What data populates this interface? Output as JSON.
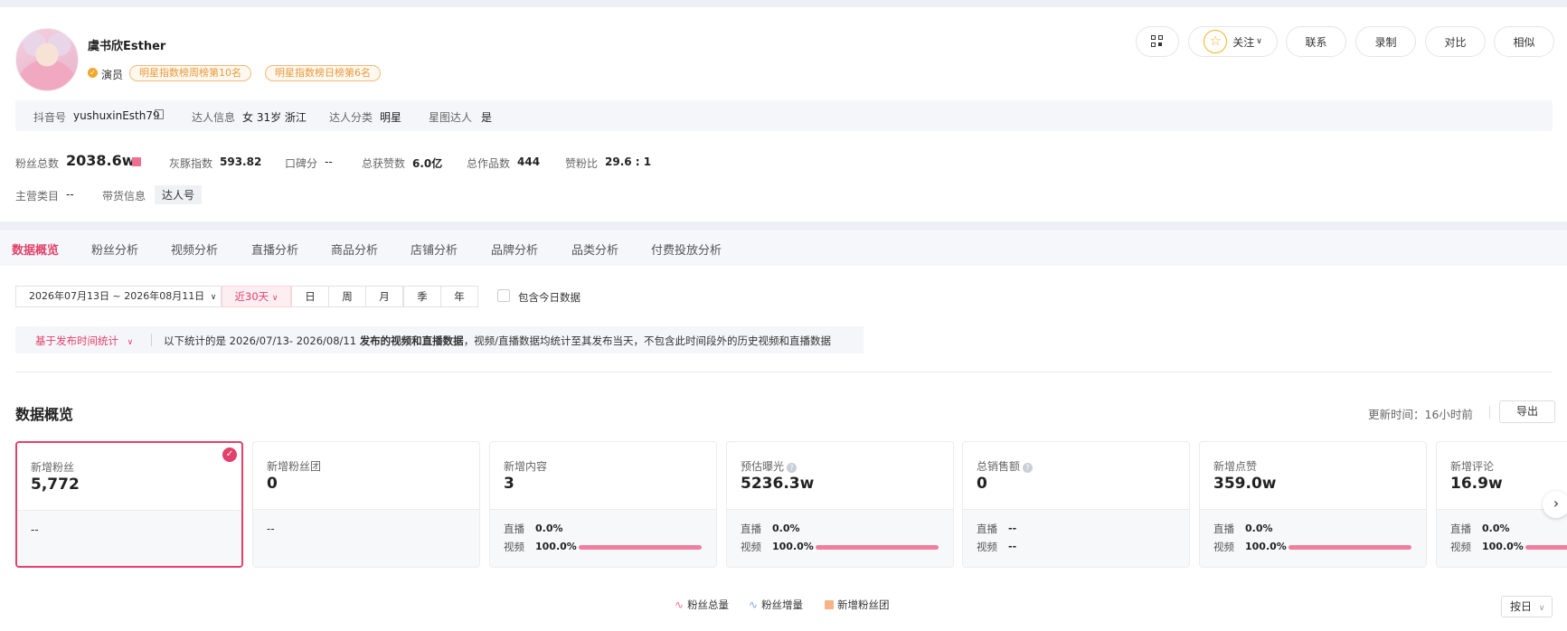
{
  "profile": {
    "name": "虞书欣Esther",
    "role": "演员",
    "rank_tags": [
      "明星指数榜周榜第10名",
      "明星指数榜日榜第6名"
    ]
  },
  "header_buttons": {
    "follow": "关注",
    "contact": "联系",
    "record": "录制",
    "compare": "对比",
    "similar": "相似"
  },
  "info": {
    "douyin_label": "抖音号",
    "douyin_value": "yushuxinEsth79",
    "talent_label": "达人信息",
    "talent_value": "女 31岁 浙江",
    "category_label": "达人分类",
    "category_value": "明星",
    "xingtu_label": "星图达人",
    "xingtu_value": "是"
  },
  "stats": {
    "fans_label": "粉丝总数",
    "fans_value": "2038.6w",
    "grey_label": "灰豚指数",
    "grey_value": "593.82",
    "reputation_label": "口碑分",
    "reputation_value": "--",
    "likes_label": "总获赞数",
    "likes_value": "6.0亿",
    "works_label": "总作品数",
    "works_value": "444",
    "ratio_label": "赞粉比",
    "ratio_value": "29.6 : 1",
    "main_cat_label": "主营类目",
    "main_cat_value": "--",
    "goods_label": "带货信息",
    "goods_value": "达人号"
  },
  "tabs": [
    "数据概览",
    "粉丝分析",
    "视频分析",
    "直播分析",
    "商品分析",
    "店铺分析",
    "品牌分析",
    "品类分析",
    "付费投放分析"
  ],
  "filters": {
    "date_range": "2026年07月13日 ~ 2026年08月11日",
    "segments": [
      "近30天",
      "日",
      "周",
      "月",
      "季",
      "年"
    ],
    "include_today": "包含今日数据"
  },
  "note": {
    "basis": "基于发布时间统计",
    "prefix": "以下统计的是 2026/07/13- 2026/08/11 ",
    "bold": "发布的视频和直播数据",
    "suffix": "，视频/直播数据均统计至其发布当天，不包含此时间段外的历史视频和直播数据"
  },
  "overview": {
    "title": "数据概览",
    "update": "更新时间：16小时前",
    "export": "导出"
  },
  "cards": [
    {
      "label": "新增粉丝",
      "value": "5,772",
      "dash": "--"
    },
    {
      "label": "新增粉丝团",
      "value": "0",
      "dash": "--"
    },
    {
      "label": "新增内容",
      "value": "3",
      "live_label": "直播",
      "live": "0.0%",
      "video_label": "视频",
      "video": "100.0%",
      "video_share": 1.0
    },
    {
      "label": "预估曝光",
      "value": "5236.3w",
      "live_label": "直播",
      "live": "0.0%",
      "video_label": "视频",
      "video": "100.0%",
      "video_share": 1.0
    },
    {
      "label": "总销售额",
      "value": "0",
      "live_label": "直播",
      "live": "--",
      "video_label": "视频",
      "video": "--"
    },
    {
      "label": "新增点赞",
      "value": "359.0w",
      "live_label": "直播",
      "live": "0.0%",
      "video_label": "视频",
      "video": "100.0%",
      "video_share": 1.0
    },
    {
      "label": "新增评论",
      "value": "16.9w",
      "live_label": "直播",
      "live": "0.0%",
      "video_label": "视频",
      "video": "100.0%",
      "video_share": 1.0
    }
  ],
  "legend": {
    "total": "粉丝总量",
    "increase": "粉丝增量",
    "club": "新增粉丝团",
    "by_day": "按日"
  },
  "colors": {
    "accent": "#e2416b",
    "tag_orange": "#e89a3c",
    "bar": "#f07e9c"
  }
}
